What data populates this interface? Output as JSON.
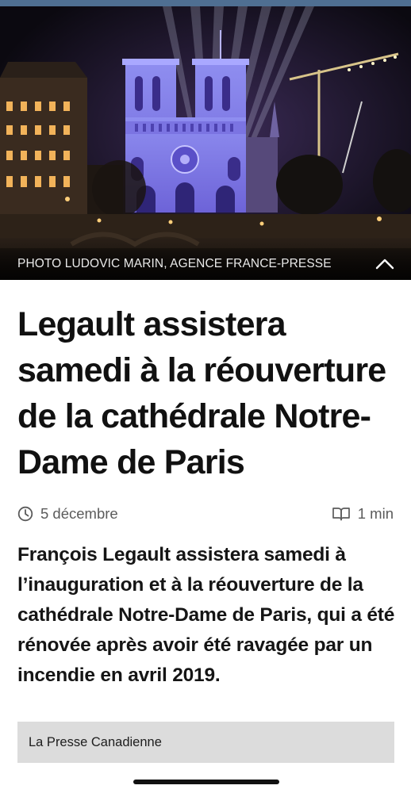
{
  "photo": {
    "credit": "PHOTO LUDOVIC MARIN, AGENCE FRANCE-PRESSE",
    "collapse_icon": "chevron-up-icon"
  },
  "article": {
    "headline": "Legault assistera samedi à la réouverture de la cathédrale Notre-Dame de Paris",
    "date": "5 décembre",
    "date_icon": "clock-icon",
    "reading_time": "1 min",
    "reading_icon": "open-book-icon",
    "lede": "François Legault assistera samedi à l’inauguration et à la réouverture de la cathédrale Notre-Dame de Paris, qui a été rénovée après avoir été ravagée par un incendie en avril 2019.",
    "source": "La Presse Canadienne"
  },
  "colors": {
    "top_strip": "#4f6f92",
    "meta_text": "#5b5b5b",
    "source_box": "#dcdcdc"
  }
}
